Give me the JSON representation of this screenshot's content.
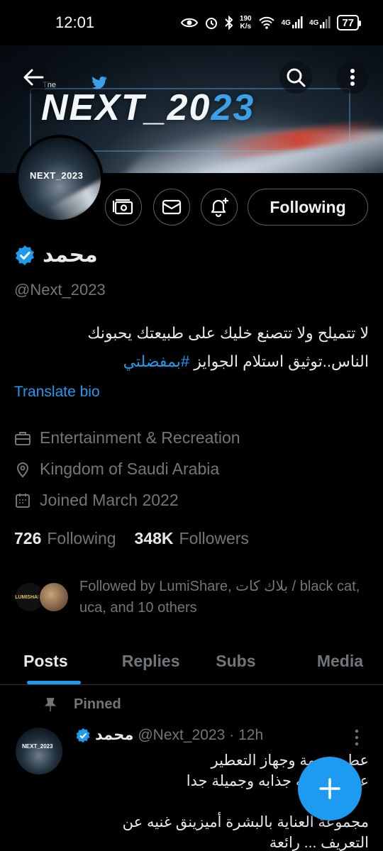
{
  "status_bar": {
    "time": "12:01",
    "net_speed_value": "190",
    "net_speed_unit": "K/s",
    "sim1_label": "4G",
    "sim2_label": "4G",
    "battery": "77"
  },
  "banner": {
    "the_text": "The",
    "brand_main": "NEXT_20",
    "brand_accent": "23"
  },
  "avatar": {
    "logo_text": "NEXT_2023"
  },
  "actions": {
    "following_label": "Following"
  },
  "profile": {
    "name": "محمد",
    "handle": "@Next_2023",
    "bio_line1": "لا تتميلح ولا تتصنع خليك على طبيعتك يحبونك",
    "bio_line2_text": "الناس..توثيق استلام الجوايز",
    "bio_hashtag": "#بمفضلتي",
    "translate_label": "Translate bio",
    "category": "Entertainment & Recreation",
    "location": "Kingdom of Saudi Arabia",
    "joined": "Joined March 2022",
    "following_count": "726",
    "following_label": "Following",
    "followers_count": "348K",
    "followers_label": "Followers",
    "followed_by": "Followed by LumiShare, بلاك كات / black cat, uca, and 10 others",
    "fb_avatar1_text": "LUMISHARE"
  },
  "tabs": [
    "Posts",
    "Replies",
    "Subs",
    "Media"
  ],
  "post": {
    "pinned_label": "Pinned",
    "author_name": "محمد",
    "author_handle": "@Next_2023",
    "time": "· 12h",
    "line1": "عطور سمة وجهاز التعطير",
    "line2": "عطور رائحه جذابه وجميلة جدا",
    "line3": "",
    "line4": "مجموعة العناية بالبشرة أميزينق غنيه عن",
    "line5": "التعريف ... رائعة",
    "avatar_text": "NEXT_2023"
  },
  "colors": {
    "accent": "#1d9bf0",
    "muted": "#71767b",
    "border": "#536471"
  }
}
